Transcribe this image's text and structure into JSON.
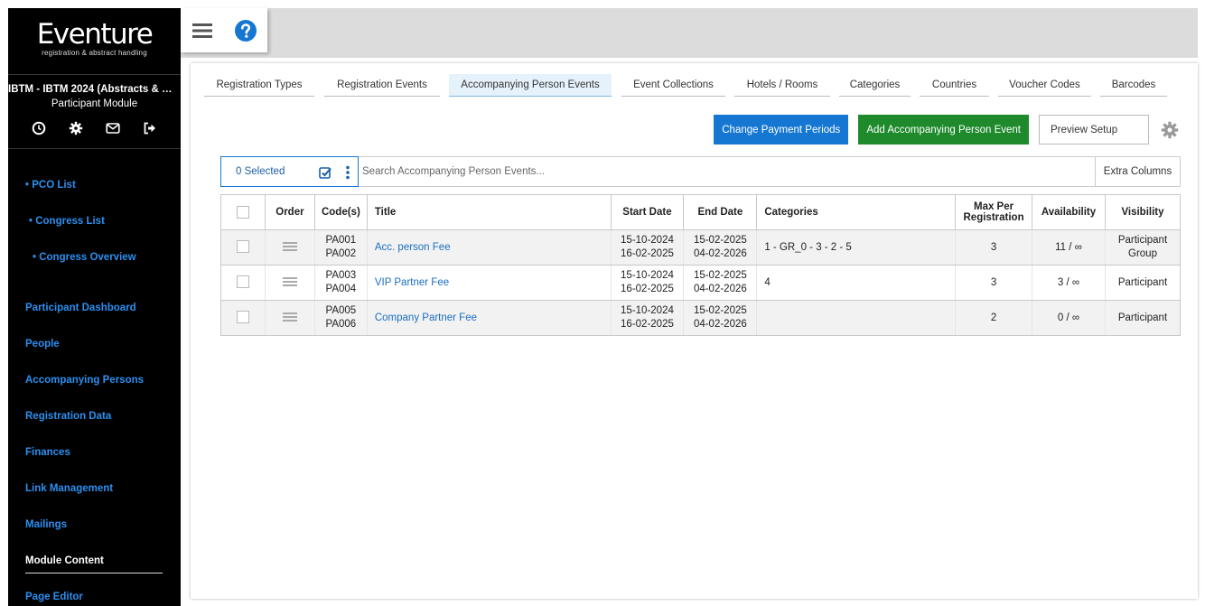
{
  "sidebar": {
    "logo_word": "Eventure",
    "logo_tagline": "registration & abstract handling",
    "project_title": "IBTM - IBTM 2024 (Abstracts & Par...",
    "module": "Participant Module",
    "icons": [
      "clock-icon",
      "gear-icon",
      "envelope-icon",
      "logout-icon"
    ],
    "nav": {
      "pco_list": "• PCO List",
      "congress_list": "• Congress List",
      "congress_overview": "• Congress Overview",
      "participant_dashboard": "Participant Dashboard",
      "people": "People",
      "accompanying_persons": "Accompanying Persons",
      "registration_data": "Registration Data",
      "finances": "Finances",
      "link_management": "Link Management",
      "mailings": "Mailings",
      "module_content": "Module Content",
      "page_editor": "Page Editor"
    }
  },
  "tabs": {
    "registration_types": "Registration Types",
    "registration_events": "Registration Events",
    "accompanying_person_events": "Accompanying Person Events",
    "event_collections": "Event Collections",
    "hotels_rooms": "Hotels / Rooms",
    "categories": "Categories",
    "countries": "Countries",
    "voucher_codes": "Voucher Codes",
    "barcodes": "Barcodes",
    "active": "Accompanying Person Events"
  },
  "actions": {
    "change_payment_periods": "Change Payment Periods",
    "add_event": "Add Accompanying Person Event",
    "preview_setup": "Preview Setup"
  },
  "search": {
    "selected": "0 Selected",
    "placeholder": "Search Accompanying Person Events...",
    "extra_columns": "Extra Columns"
  },
  "table": {
    "headers": {
      "order": "Order",
      "codes": "Code(s)",
      "title": "Title",
      "start_date": "Start Date",
      "end_date": "End Date",
      "categories": "Categories",
      "max_per_registration_1": "Max Per",
      "max_per_registration_2": "Registration",
      "availability": "Availability",
      "visibility": "Visibility"
    },
    "rows": [
      {
        "code1": "PA001",
        "code2": "PA002",
        "title": "Acc. person Fee",
        "start1": "15-10-2024",
        "start2": "16-02-2025",
        "end1": "15-02-2025",
        "end2": "04-02-2026",
        "categories": "1 - GR_0 - 3 - 2 - 5",
        "max": "3",
        "availability": "11 / ∞",
        "visibility1": "Participant",
        "visibility2": "Group"
      },
      {
        "code1": "PA003",
        "code2": "PA004",
        "title": "VIP Partner Fee",
        "start1": "15-10-2024",
        "start2": "16-02-2025",
        "end1": "15-02-2025",
        "end2": "04-02-2026",
        "categories": "4",
        "max": "3",
        "availability": "3 / ∞",
        "visibility1": "Participant",
        "visibility2": ""
      },
      {
        "code1": "PA005",
        "code2": "PA006",
        "title": "Company Partner Fee",
        "start1": "15-10-2024",
        "start2": "16-02-2025",
        "end1": "15-02-2025",
        "end2": "04-02-2026",
        "categories": "",
        "max": "2",
        "availability": "0 / ∞",
        "visibility1": "Participant",
        "visibility2": ""
      }
    ]
  },
  "colors": {
    "primary_blue": "#1677d2",
    "success_green": "#1e8a2c",
    "sidebar_bg": "#000000",
    "nav_link": "#2b8ff0",
    "active_tab_bg": "#e6f2fb"
  },
  "topbar_icons": [
    "hamburger-icon",
    "help-icon"
  ]
}
